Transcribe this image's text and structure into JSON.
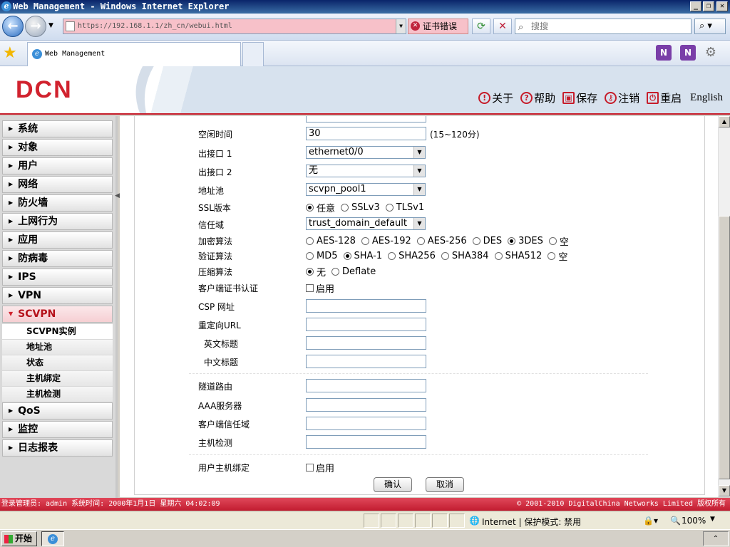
{
  "window": {
    "title": "Web Management - Windows Internet Explorer",
    "minimize": "_",
    "maximize": "❐",
    "close": "✕"
  },
  "browser": {
    "url": "https://192.168.1.1/zh_cn/webui.html",
    "cert_error": "证书错误",
    "search_placeholder": "搜搜",
    "tab_title": "Web Management",
    "zoom": "100%",
    "zone": "Internet | 保护模式: 禁用"
  },
  "header": {
    "logo": "DCN",
    "nav": [
      {
        "icon": "!",
        "label": "关于"
      },
      {
        "icon": "?",
        "label": "帮助"
      },
      {
        "icon": "▣",
        "label": "保存"
      },
      {
        "icon": "⚷",
        "label": "注销"
      },
      {
        "icon": "⏻",
        "label": "重启"
      }
    ],
    "language": "English"
  },
  "sidebar": {
    "items": [
      {
        "label": "系统"
      },
      {
        "label": "对象"
      },
      {
        "label": "用户"
      },
      {
        "label": "网络"
      },
      {
        "label": "防火墙"
      },
      {
        "label": "上网行为"
      },
      {
        "label": "应用"
      },
      {
        "label": "防病毒"
      },
      {
        "label": "IPS"
      },
      {
        "label": "VPN"
      }
    ],
    "open_item": "SCVPN",
    "sub_items": [
      "SCVPN实例",
      "地址池",
      "状态",
      "主机绑定",
      "主机检测"
    ],
    "after_items": [
      {
        "label": "QoS"
      },
      {
        "label": "监控"
      },
      {
        "label": "日志报表"
      }
    ]
  },
  "form": {
    "idle_time": {
      "label": "空闲时间",
      "value": "30",
      "hint": "(15~120分)"
    },
    "out_if1": {
      "label": "出接口 1",
      "value": "ethernet0/0"
    },
    "out_if2": {
      "label": "出接口 2",
      "value": "无"
    },
    "pool": {
      "label": "地址池",
      "value": "scvpn_pool1"
    },
    "ssl_version": {
      "label": "SSL版本",
      "options": [
        "任意",
        "SSLv3",
        "TLSv1"
      ],
      "selected": "任意"
    },
    "trust_domain": {
      "label": "信任域",
      "value": "trust_domain_default"
    },
    "encryption": {
      "label": "加密算法",
      "options": [
        "AES-128",
        "AES-192",
        "AES-256",
        "DES",
        "3DES",
        "空"
      ],
      "selected": "3DES"
    },
    "auth": {
      "label": "验证算法",
      "options": [
        "MD5",
        "SHA-1",
        "SHA256",
        "SHA384",
        "SHA512",
        "空"
      ],
      "selected": "SHA-1"
    },
    "compress": {
      "label": "压缩算法",
      "options": [
        "无",
        "Deflate"
      ],
      "selected": "无"
    },
    "client_cert": {
      "label": "客户端证书认证",
      "checkbox": "启用"
    },
    "csp_url": {
      "label": "CSP 网址",
      "value": ""
    },
    "redirect_url": {
      "label": "重定向URL",
      "value": ""
    },
    "en_title": {
      "label": "英文标题",
      "value": ""
    },
    "cn_title": {
      "label": "中文标题",
      "value": ""
    },
    "tunnel_route": {
      "label": "隧道路由",
      "value": ""
    },
    "aaa": {
      "label": "AAA服务器",
      "value": ""
    },
    "client_trust": {
      "label": "客户端信任域",
      "value": ""
    },
    "host_check": {
      "label": "主机检测",
      "value": ""
    },
    "user_host_bind": {
      "label": "用户主机绑定",
      "checkbox": "启用"
    },
    "ok": "确认",
    "cancel": "取消"
  },
  "footer": {
    "left": "登录管理员: admin 系统时间: 2000年1月1日 星期六 04:02:09",
    "right": "© 2001-2010 DigitalChina Networks Limited 版权所有"
  },
  "taskbar": {
    "start": "开始"
  }
}
